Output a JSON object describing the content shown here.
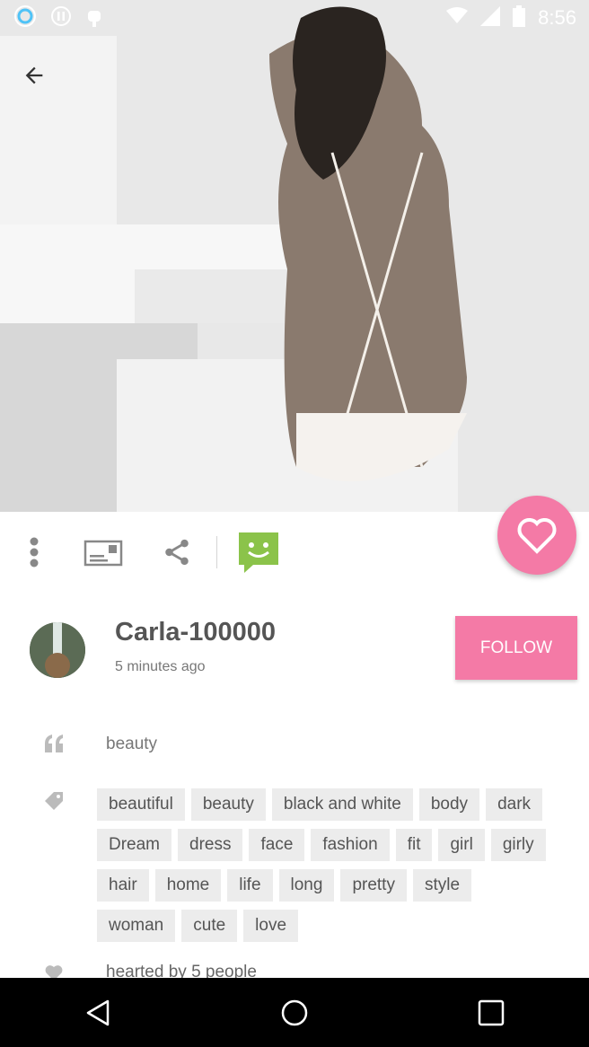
{
  "status_bar": {
    "time": "8:56"
  },
  "author": {
    "username": "Carla-100000",
    "time_ago": "5 minutes ago"
  },
  "follow_label": "FOLLOW",
  "caption": "beauty",
  "tags": [
    "beautiful",
    "beauty",
    "black and white",
    "body",
    "dark",
    "Dream",
    "dress",
    "face",
    "fashion",
    "fit",
    "girl",
    "girly",
    "hair",
    "home",
    "life",
    "long",
    "pretty",
    "style",
    "woman",
    "cute",
    "love"
  ],
  "hearted_text": "hearted by 5 people",
  "colors": {
    "accent": "#f47aa6",
    "chat_green": "#8bc34a"
  },
  "icons": [
    "back-arrow-icon",
    "more-vert-icon",
    "card-icon",
    "share-icon",
    "chat-icon",
    "heart-icon",
    "quote-icon",
    "tag-icon"
  ]
}
